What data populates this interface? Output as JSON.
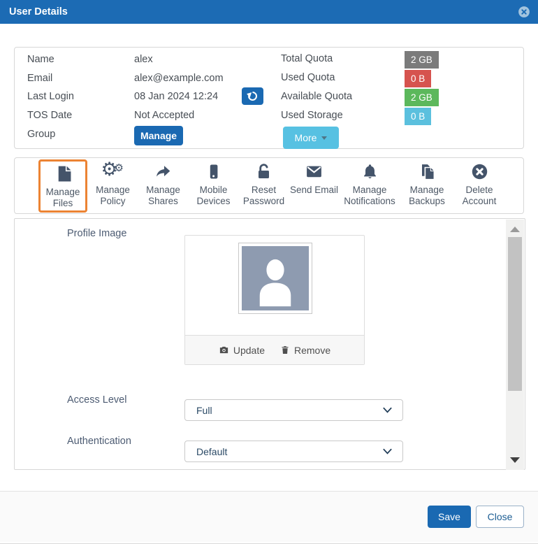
{
  "window": {
    "title": "User Details"
  },
  "colors": {
    "header_bg": "#1c6bb4",
    "primary_blue": "#1a69b2",
    "info_blue": "#57c1e2",
    "highlight_orange": "#ec8333",
    "icon_slate": "#44546a"
  },
  "info_panel": {
    "rows_left": [
      {
        "label": "Name",
        "value": "alex"
      },
      {
        "label": "Email",
        "value": "alex@example.com"
      },
      {
        "label": "Last Login",
        "value": "08 Jan 2024 12:24"
      },
      {
        "label": "TOS Date",
        "value": "Not Accepted"
      },
      {
        "label": "Group"
      }
    ],
    "manage_button": "Manage",
    "rows_right": [
      {
        "label": "Total Quota",
        "badge": "2 GB",
        "color": "#7b7b7b"
      },
      {
        "label": "Used Quota",
        "badge": "0 B",
        "color": "#d6534e"
      },
      {
        "label": "Available Quota",
        "badge": "2 GB",
        "color": "#5cb85c"
      },
      {
        "label": "Used Storage",
        "badge": "0 B",
        "color": "#5bc0de"
      }
    ],
    "more_button": "More"
  },
  "toolbar": {
    "items": [
      {
        "label": "Manage Files",
        "icon": "file-icon",
        "highlighted": true
      },
      {
        "label": "Manage Policy",
        "icon": "gears-icon"
      },
      {
        "label": "Manage Shares",
        "icon": "share-arrow-icon"
      },
      {
        "label": "Mobile Devices",
        "icon": "mobile-icon"
      },
      {
        "label": "Reset Password",
        "icon": "unlock-icon"
      },
      {
        "label": "Send Email",
        "icon": "envelope-icon"
      },
      {
        "label": "Manage Notifications",
        "icon": "bell-icon"
      },
      {
        "label": "Manage Backups",
        "icon": "copy-icon"
      },
      {
        "label": "Delete Account",
        "icon": "circle-x-icon"
      }
    ]
  },
  "form": {
    "profile_image_label": "Profile Image",
    "update_button": "Update",
    "remove_button": "Remove",
    "access_level": {
      "label": "Access Level",
      "value": "Full"
    },
    "authentication": {
      "label": "Authentication",
      "value": "Default"
    }
  },
  "footer": {
    "save": "Save",
    "close": "Close"
  },
  "icons": [
    "close-circle-icon",
    "refresh-icon",
    "caret-down-icon",
    "camera-icon",
    "trash-icon",
    "chevron-down-icon",
    "person-icon",
    "scroll-up-icon",
    "scroll-down-icon"
  ]
}
